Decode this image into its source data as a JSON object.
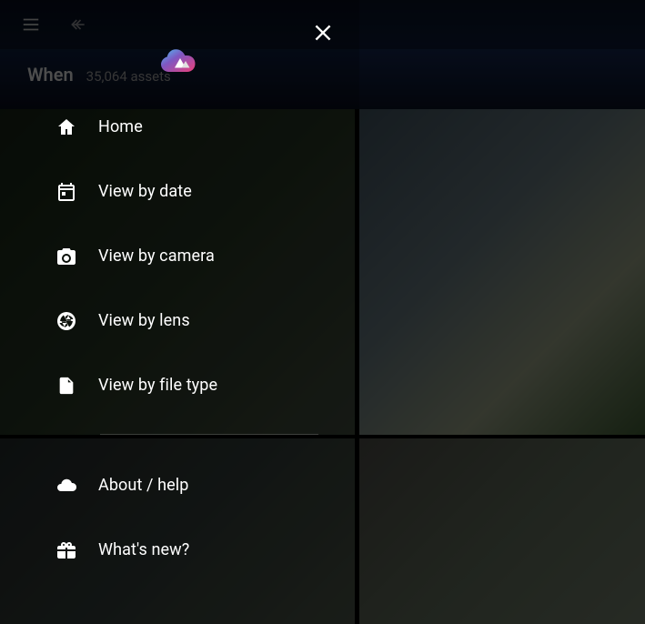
{
  "header": {
    "title": "When",
    "asset_count_text": "35,064 assets"
  },
  "drawer": {
    "nav": [
      {
        "icon": "home",
        "label": "Home"
      },
      {
        "icon": "calendar",
        "label": "View by date"
      },
      {
        "icon": "camera",
        "label": "View by camera"
      },
      {
        "icon": "lens",
        "label": "View by lens"
      },
      {
        "icon": "file",
        "label": "View by file type"
      }
    ],
    "footer": [
      {
        "icon": "cloud",
        "label": "About / help"
      },
      {
        "icon": "gift",
        "label": "What's new?"
      }
    ]
  }
}
